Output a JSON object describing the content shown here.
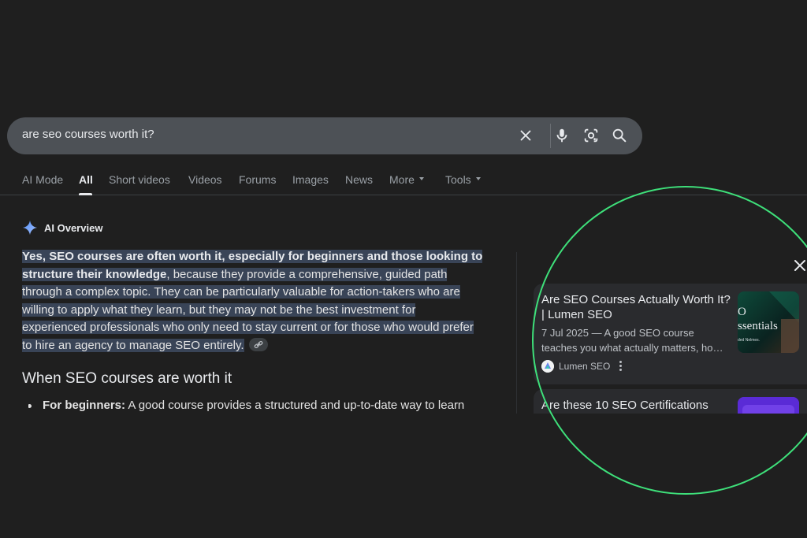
{
  "search": {
    "query": "are seo courses worth it?"
  },
  "tabs": [
    {
      "label": "AI Mode"
    },
    {
      "label": "All"
    },
    {
      "label": "Short videos"
    },
    {
      "label": "Videos"
    },
    {
      "label": "Forums"
    },
    {
      "label": "Images"
    },
    {
      "label": "News"
    },
    {
      "label": "More"
    },
    {
      "label": "Tools"
    }
  ],
  "ai_overview": {
    "title": "AI Overview",
    "bold_part_line1": "Yes, SEO courses are often worth it, especially for beginners and those looking to",
    "bold_part_line2": "structure their knowledge",
    "rest_line2": ", because they provide a comprehensive, guided path",
    "line3": "through a complex topic. They can be particularly valuable for action-takers who are",
    "line4": "willing to apply what they learn, but they may not be the best investment for",
    "line5": "experienced professionals who only need to stay current or for those who would prefer",
    "line6": "to hire an agency to manage SEO entirely.",
    "section_heading": "When SEO courses are worth it",
    "bullet_label": "For beginners:",
    "bullet_text": " A good course provides a structured and up-to-date way to learn"
  },
  "sources": [
    {
      "title_line1": "Are SEO Courses Actually Worth It?",
      "title_line2": "| Lumen SEO",
      "snippet_line1": "7 Jul 2025 — A good SEO course",
      "snippet_line2": "teaches you what actually matters, ho…",
      "source_name": "Lumen SEO",
      "thumb_text_1": "O",
      "thumb_text_2": "ssentials",
      "thumb_text_3": "ded Nelmes."
    },
    {
      "title_line1": "Are these 10 SEO Certifications"
    }
  ],
  "colors": {
    "background": "#1f1f1f",
    "search_bar": "#4d5156",
    "highlight": "#394457",
    "ring": "#3ee07a"
  }
}
